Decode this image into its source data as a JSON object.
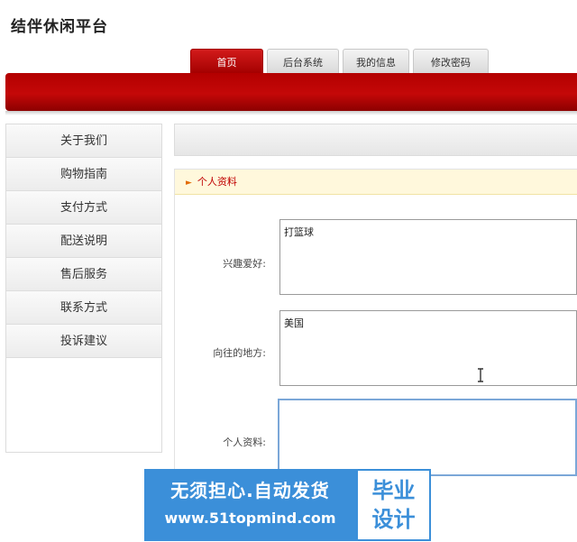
{
  "site": {
    "title": "结伴休闲平台"
  },
  "nav": {
    "tabs": [
      {
        "label": "首页",
        "active": true
      },
      {
        "label": "后台系统",
        "active": false
      },
      {
        "label": "我的信息",
        "active": false
      },
      {
        "label": "修改密码",
        "active": false
      }
    ]
  },
  "sidebar": {
    "items": [
      {
        "label": "关于我们"
      },
      {
        "label": "购物指南"
      },
      {
        "label": "支付方式"
      },
      {
        "label": "配送说明"
      },
      {
        "label": "售后服务"
      },
      {
        "label": "联系方式"
      },
      {
        "label": "投诉建议"
      }
    ]
  },
  "panel": {
    "title": "个人资料",
    "fields": [
      {
        "label": "兴趣爱好:",
        "value": "打篮球"
      },
      {
        "label": "向往的地方:",
        "value": "美国"
      },
      {
        "label": "个人资料:",
        "value": ""
      }
    ]
  },
  "watermark": {
    "line1": "无须担心.自动发货",
    "line2": "www.51topmind.com",
    "badge_top": "毕业",
    "badge_bottom": "设计"
  },
  "colors": {
    "brand_red": "#b30000",
    "panel_header_bg": "#fff8dc",
    "watermark_blue": "#3b8fd9"
  }
}
